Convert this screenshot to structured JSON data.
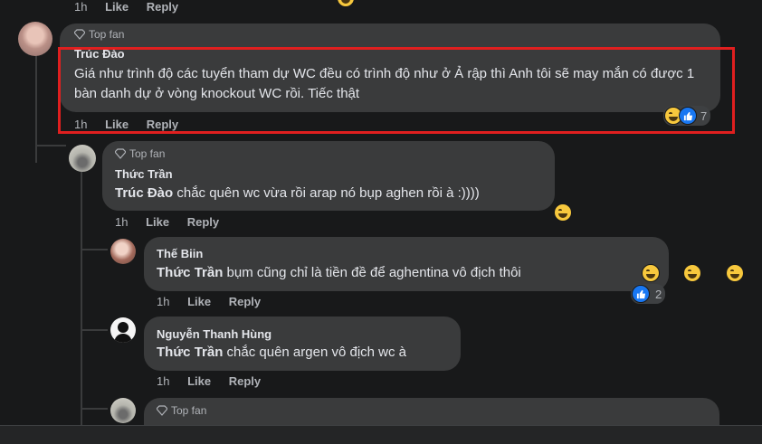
{
  "top_actions": {
    "time": "1h",
    "like": "Like",
    "reply": "Reply"
  },
  "comment_main": {
    "badge": "Top fan",
    "author": "Trúc Đào",
    "text": "Giá như trình độ các tuyển tham dự WC đều có trình độ như ở Ả rập thì Anh tôi sẽ may mắn có được 1 bàn danh dự ở vòng knockout WC rồi. Tiếc thật",
    "time": "1h",
    "like": "Like",
    "reply": "Reply",
    "reaction_count": "7"
  },
  "reply_1": {
    "badge": "Top fan",
    "author": "Thức Trần",
    "mention": "Trúc Đào",
    "text": " chắc quên wc vừa rồi arap nó bụp aghen rồi à :))))",
    "time": "1h",
    "like": "Like",
    "reply": "Reply"
  },
  "reply_2": {
    "author": "Thế Biin",
    "mention": "Thức Trần",
    "text": " bụm cũng chỉ là tiền đề để aghentina vô địch thôi",
    "time": "1h",
    "like": "Like",
    "reply": "Reply",
    "reaction_count": "2"
  },
  "reply_3": {
    "author": "Nguyễn Thanh Hùng",
    "mention": "Thức Trần",
    "text": " chắc quên argen vô địch wc à",
    "time": "1h",
    "like": "Like",
    "reply": "Reply"
  },
  "reply_4": {
    "badge": "Top fan"
  },
  "colors": {
    "highlight": "#e01f1f",
    "bubble": "#3a3b3c",
    "background": "#18191a",
    "like_blue": "#1877f2"
  }
}
